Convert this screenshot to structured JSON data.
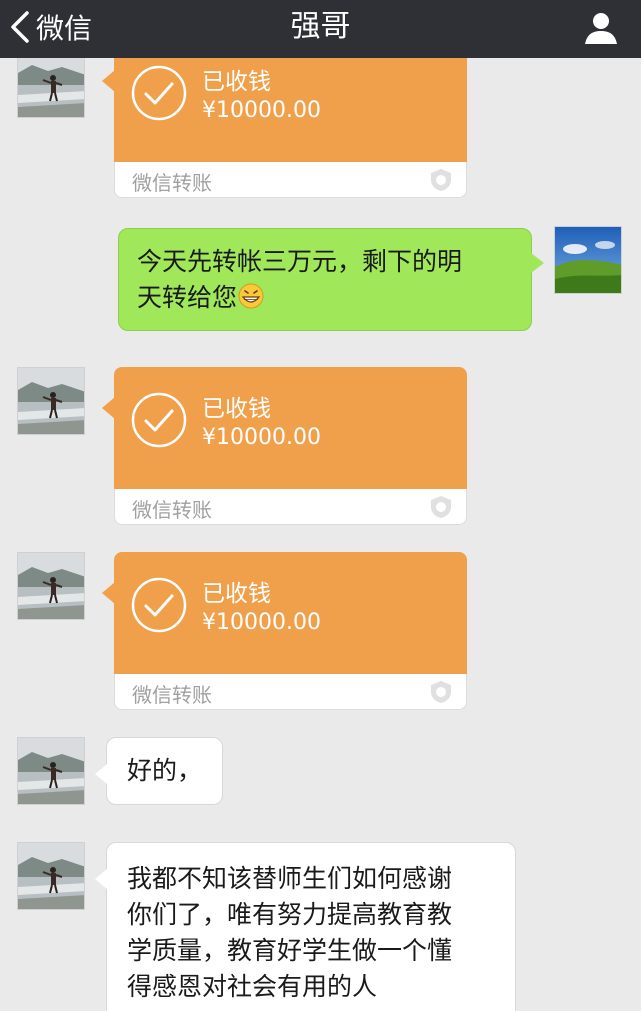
{
  "header": {
    "back_label": "微信",
    "title": "强哥"
  },
  "colors": {
    "navbar": "#2f3035",
    "transfer_orange": "#f0a04b",
    "bubble_green": "#a0e75a",
    "background": "#eaeaea"
  },
  "icons": [
    "chevron-left-icon",
    "profile-icon",
    "check-circle-icon",
    "shield-icon",
    "grinning-emoji-icon"
  ],
  "messages": {
    "t1": {
      "status": "已收钱",
      "amount": "¥10000.00",
      "footer": "微信转账"
    },
    "sent": {
      "line1": "今天先转帐三万元，剩下的明",
      "line2": "天转给您"
    },
    "t2": {
      "status": "已收钱",
      "amount": "¥10000.00",
      "footer": "微信转账"
    },
    "t3": {
      "status": "已收钱",
      "amount": "¥10000.00",
      "footer": "微信转账"
    },
    "reply1": {
      "text": "好的，"
    },
    "reply2": {
      "line1": "我都不知该替师生们如何感谢",
      "line2": "你们了，唯有努力提高教育教",
      "line3": "学质量，教育好学生做一个懂",
      "line4": "得感恩对社会有用的人"
    }
  }
}
